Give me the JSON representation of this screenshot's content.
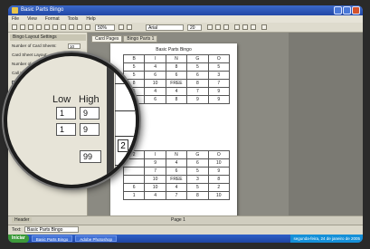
{
  "window": {
    "title": "Basic Parts Bingo"
  },
  "menu": [
    "File",
    "View",
    "Format",
    "Tools",
    "Help"
  ],
  "toolbar": {
    "zoom": "50%",
    "font": "Arial",
    "size": "20"
  },
  "left_panel": {
    "header": "Bingo Layout Settings",
    "rows": [
      {
        "label": "Number of Card Sheets:",
        "value": "10"
      },
      {
        "label": "Card Sheet Layout:",
        "value": "2 x 1"
      },
      {
        "label": "Number of Cell Blanks:",
        "value": "0"
      },
      {
        "label": "Call Items per Column:",
        "value": "15"
      }
    ],
    "checks": [
      "Include Free Cell",
      "Show Border"
    ]
  },
  "tabs": [
    "Card Pages",
    "Bingo Parts 1"
  ],
  "sheet": {
    "title": "Basic Parts Bingo",
    "card1": {
      "headers": [
        "B",
        "I",
        "N",
        "G",
        "O"
      ],
      "rows": [
        [
          "5",
          "4",
          "8",
          "5",
          "5"
        ],
        [
          "5",
          "6",
          "6",
          "6",
          "3"
        ],
        [
          "8",
          "10",
          "FREE",
          "8",
          "7"
        ],
        [
          "5",
          "4",
          "4",
          "7",
          "9"
        ],
        [
          "5",
          "6",
          "8",
          "9",
          "9"
        ]
      ]
    },
    "card2": {
      "number": "2",
      "headers": [
        "",
        "I",
        "N",
        "G",
        "O"
      ],
      "rows": [
        [
          "",
          "9",
          "4",
          "6",
          "10"
        ],
        [
          "",
          "7",
          "6",
          "5",
          "9"
        ],
        [
          "",
          "10",
          "FREE",
          "3",
          "8"
        ],
        [
          "6",
          "10",
          "4",
          "5",
          "2"
        ],
        [
          "1",
          "4",
          "7",
          "8",
          "10"
        ]
      ]
    }
  },
  "page_indicator": "Page 1",
  "header_footer": {
    "label": "Header",
    "text_label": "Text:",
    "text_value": "Basic Parts Bingo"
  },
  "taskbar": {
    "start": "Iniciar",
    "items": [
      "Basic Parts Bingo",
      "Adobe Photoshop"
    ],
    "tray_time": "segunda-feira, 24 de janeiro de 2005"
  },
  "magnifier": {
    "low_label": "Low",
    "high_label": "High",
    "row1": {
      "low": "1",
      "high": "9"
    },
    "row2": {
      "low": "1",
      "high": "9"
    },
    "max_label": "x:",
    "max_value": "99",
    "card_number": "2"
  }
}
